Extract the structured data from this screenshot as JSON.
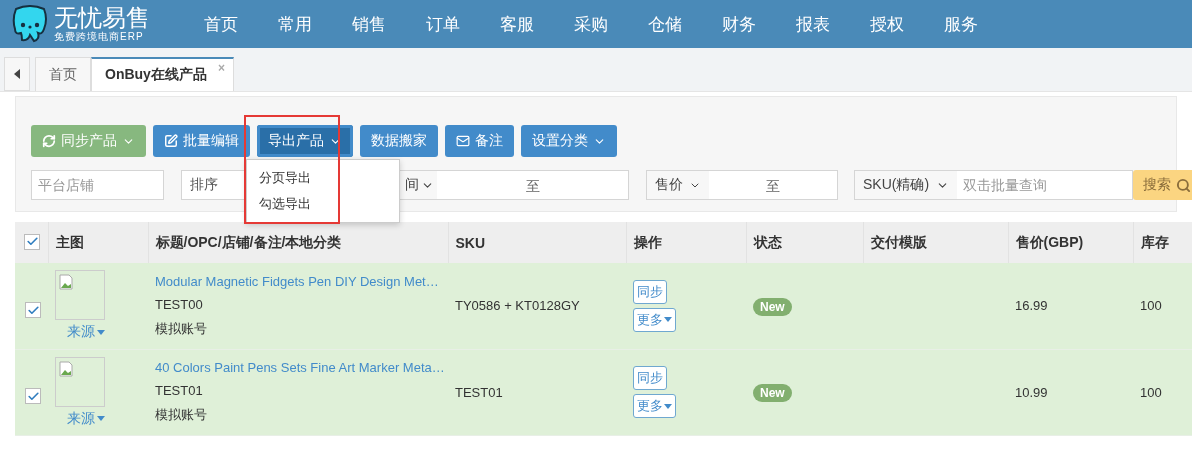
{
  "header": {
    "logo": {
      "title": "无忧易售",
      "subtitle": "免费跨境电商ERP"
    },
    "nav": [
      "首页",
      "常用",
      "销售",
      "订单",
      "客服",
      "采购",
      "仓储",
      "财务",
      "报表",
      "授权",
      "服务"
    ]
  },
  "tabs": [
    {
      "label": "首页",
      "selected": false
    },
    {
      "label": "OnBuy在线产品",
      "selected": true,
      "close_label": "×"
    }
  ],
  "toolbar": [
    {
      "label": "同步产品",
      "kind": "success",
      "caret": true,
      "open": false
    },
    {
      "label": "批量编辑",
      "kind": "primary",
      "caret": false,
      "open": false
    },
    {
      "label": "导出产品",
      "kind": "primary",
      "caret": true,
      "open": true
    },
    {
      "label": "数据搬家",
      "kind": "primary",
      "caret": false,
      "open": false
    },
    {
      "label": "备注",
      "kind": "primary",
      "caret": false,
      "open": false
    },
    {
      "label": "设置分类",
      "kind": "primary",
      "caret": true,
      "open": false
    }
  ],
  "export_menu": {
    "items": [
      "分页导出",
      "勾选导出"
    ]
  },
  "filters": [
    {
      "kind": "input",
      "placeholder": "平台店铺"
    },
    {
      "kind": "select",
      "value": "排序"
    },
    {
      "kind": "select-range",
      "value": "间",
      "separator": "至"
    },
    {
      "kind": "select-range",
      "value": "售价",
      "separator": "至"
    },
    {
      "kind": "select-input",
      "value": "SKU(精确)",
      "placeholder": "双击批量查询"
    },
    {
      "kind": "button",
      "label": "搜索"
    }
  ],
  "table": {
    "select_all": true,
    "columns": [
      "主图",
      "标题/OPC/店铺/备注/本地分类",
      "SKU",
      "操作",
      "状态",
      "交付模版",
      "售价(GBP)",
      "库存"
    ],
    "rows": [
      {
        "checked": true,
        "source": "来源",
        "title": "Modular Magnetic Fidgets Pen DIY Design Met…",
        "opc": "TEST00",
        "store": "模拟账号",
        "sku": "TY0586 + KT0128GY",
        "actions": [
          "同步",
          "更多"
        ],
        "status": "New",
        "price": "16.99",
        "stock": "100"
      },
      {
        "checked": true,
        "source": "来源",
        "title": "40 Colors Paint Pens Sets Fine Art Marker Meta…",
        "opc": "TEST01",
        "store": "模拟账号",
        "sku": "TEST01",
        "actions": [
          "同步",
          "更多"
        ],
        "status": "New",
        "price": "10.99",
        "stock": "100"
      }
    ]
  }
}
